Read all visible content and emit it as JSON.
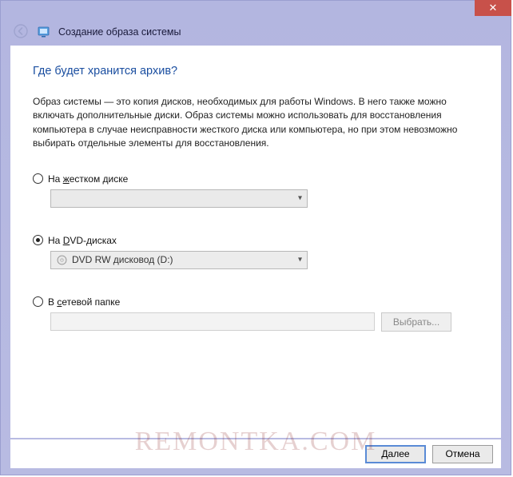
{
  "window": {
    "title": "Создание образа системы"
  },
  "page": {
    "heading": "Где будет хранится архив?",
    "description": "Образ системы — это копия дисков, необходимых для работы Windows. В него также можно включать дополнительные диски. Образ системы можно использовать для восстановления компьютера в случае неисправности жесткого диска или компьютера, но при этом невозможно выбирать отдельные элементы для восстановления."
  },
  "options": {
    "hdd": {
      "label_prefix": "На ",
      "label_key": "ж",
      "label_rest": "естком диске",
      "selected": "",
      "enabled": false,
      "checked": false
    },
    "dvd": {
      "label_prefix": "На ",
      "label_key": "D",
      "label_rest": "VD-дисках",
      "selected": "DVD RW дисковод (D:)",
      "checked": true
    },
    "network": {
      "label_prefix": "В ",
      "label_key": "с",
      "label_rest": "етевой папке",
      "value": "",
      "browse_label": "Выбрать...",
      "checked": false
    }
  },
  "footer": {
    "next": "Далее",
    "cancel": "Отмена"
  },
  "watermark": "REMONTKA.COM"
}
